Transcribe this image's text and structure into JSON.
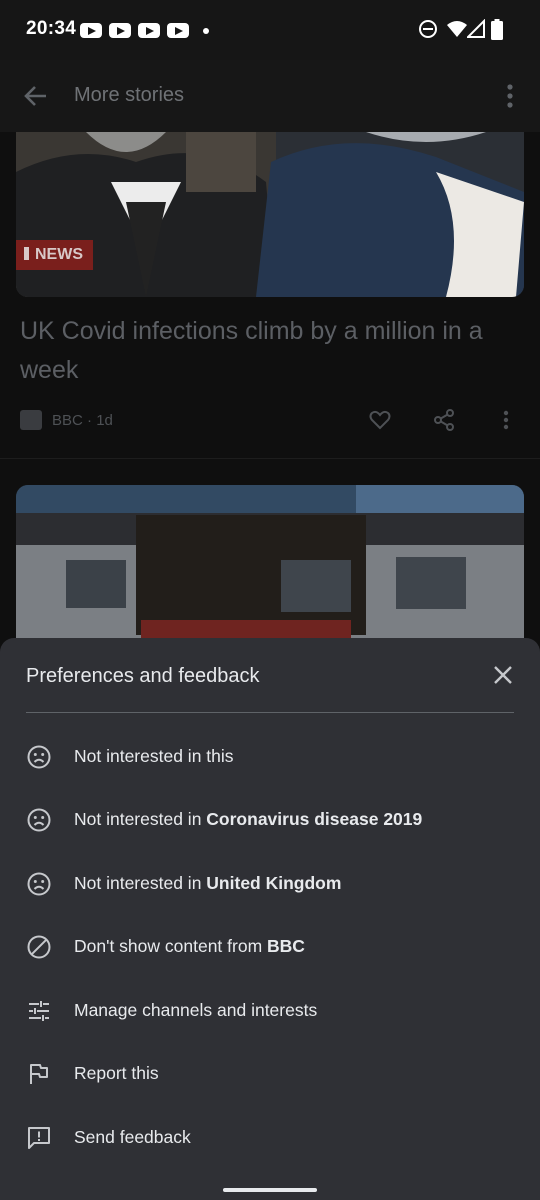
{
  "status_bar": {
    "time": "20:34",
    "notification_icons": [
      "youtube-icon",
      "youtube-icon",
      "youtube-icon",
      "youtube-icon",
      "dot"
    ],
    "system_icons": [
      "do-not-disturb-icon",
      "wifi-icon",
      "signal-icon",
      "battery-icon"
    ]
  },
  "app_bar": {
    "title": "More stories",
    "back_icon": "arrow-back-icon",
    "menu_icon": "more-vert-icon"
  },
  "feed": {
    "stories": [
      {
        "badge": "NEWS",
        "title": "UK Covid infections climb by a million in a week",
        "source": "BBC",
        "age": "1d",
        "meta_separator": " · ",
        "actions": [
          "heart-icon",
          "share-icon",
          "more-vert-icon"
        ]
      },
      {
        "image": "burnt-house-photo"
      }
    ]
  },
  "sheet": {
    "title": "Preferences and feedback",
    "close_icon": "close-icon",
    "items": [
      {
        "icon": "sad-face-icon",
        "label": "Not interested in this",
        "bold": ""
      },
      {
        "icon": "sad-face-icon",
        "label": "Not interested in ",
        "bold": "Coronavirus disease 2019"
      },
      {
        "icon": "sad-face-icon",
        "label": "Not interested in ",
        "bold": "United Kingdom"
      },
      {
        "icon": "block-icon",
        "label": "Don't show content from ",
        "bold": "BBC"
      },
      {
        "icon": "tune-icon",
        "label": "Manage channels and interests",
        "bold": ""
      },
      {
        "icon": "flag-icon",
        "label": "Report this",
        "bold": ""
      },
      {
        "icon": "feedback-icon",
        "label": "Send feedback",
        "bold": ""
      }
    ]
  },
  "colors": {
    "sheet_background": "#2f3035",
    "scrim_background": "#0f0f0f",
    "text_primary": "#e8eaed",
    "badge_red": "#7a1f1c"
  }
}
